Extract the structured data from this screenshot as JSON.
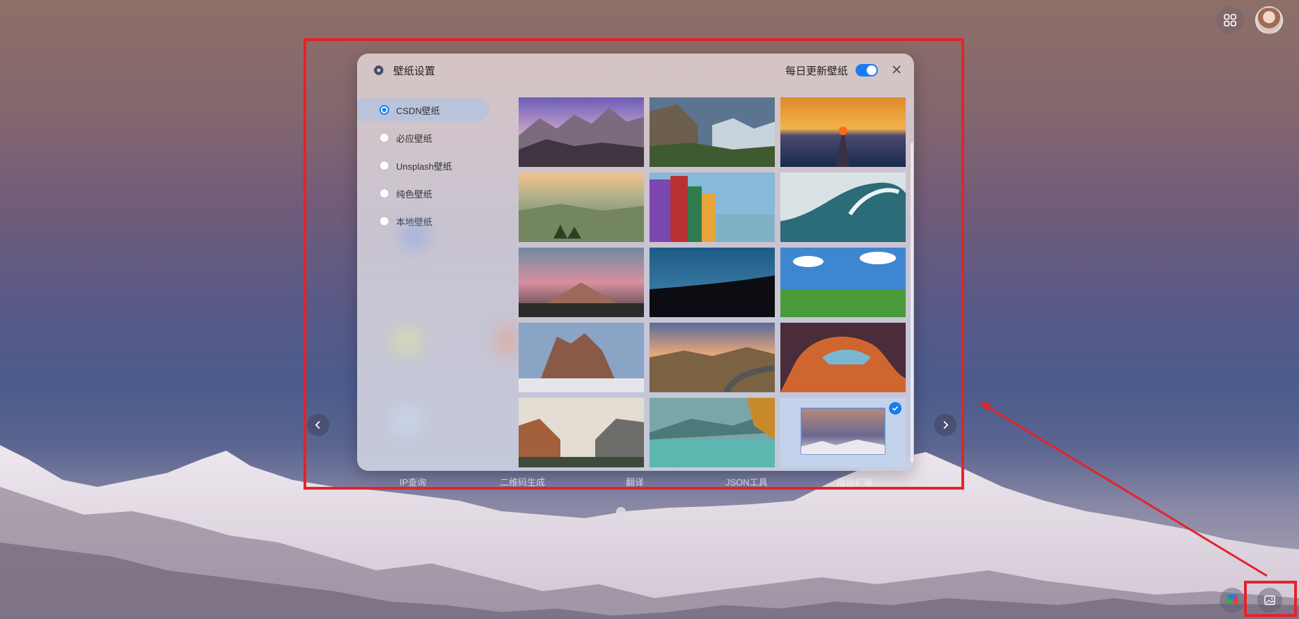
{
  "dialog": {
    "title": "壁纸设置",
    "daily_update_label": "每日更新壁纸",
    "daily_update_enabled": true
  },
  "sidebar": {
    "items": [
      {
        "label": "CSDN壁纸",
        "selected": true
      },
      {
        "label": "必应壁纸",
        "selected": false
      },
      {
        "label": "Unsplash壁纸",
        "selected": false
      },
      {
        "label": "纯色壁纸",
        "selected": false
      },
      {
        "label": "本地壁纸",
        "selected": false
      }
    ]
  },
  "wallpapers": [
    {
      "name": "purple-mountain-sunrise"
    },
    {
      "name": "yosemite-valley"
    },
    {
      "name": "lake-sunset-pier"
    },
    {
      "name": "misty-green-hills"
    },
    {
      "name": "colorful-houses-harbor"
    },
    {
      "name": "ocean-wave"
    },
    {
      "name": "desert-hill-pink-clouds"
    },
    {
      "name": "dark-hill-silhouette"
    },
    {
      "name": "green-plain-blue-sky"
    },
    {
      "name": "rocky-peaks-snow"
    },
    {
      "name": "mountain-road-sunset"
    },
    {
      "name": "antelope-canyon"
    },
    {
      "name": "canyon-valley"
    },
    {
      "name": "turquoise-lake"
    },
    {
      "name": "snow-mountain-current",
      "selected": true
    }
  ],
  "background_labels": [
    "IP查询",
    "二维码生成",
    "翻译",
    "JSON工具",
    "插件扩展"
  ],
  "icons": {
    "settings": "gear-icon",
    "close": "close-icon",
    "apps": "apps-grid-icon",
    "prev": "chevron-left-icon",
    "next": "chevron-right-icon",
    "wallpaper": "image-icon"
  },
  "colors": {
    "accent": "#1b7cf0",
    "annotation": "#e5222a"
  }
}
